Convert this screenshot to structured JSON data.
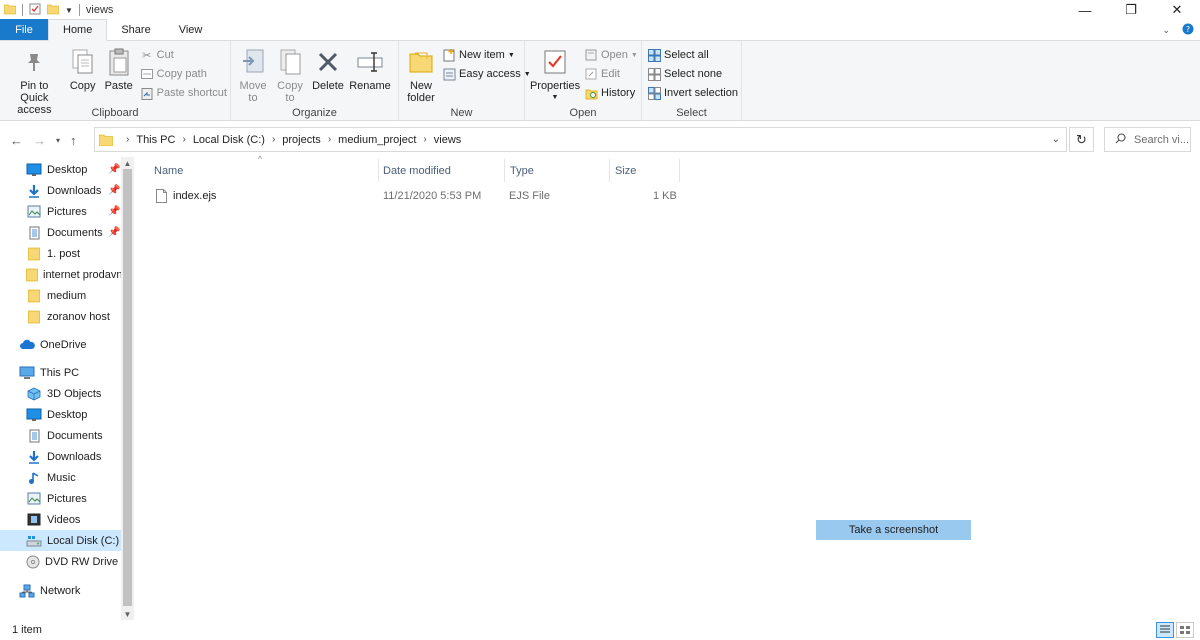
{
  "window": {
    "title": "views",
    "controls": {
      "minimize": "—",
      "maximize": "❐",
      "close": "✕"
    }
  },
  "ribbon_tabs": [
    {
      "label": "File"
    },
    {
      "label": "Home"
    },
    {
      "label": "Share"
    },
    {
      "label": "View"
    }
  ],
  "ribbon": {
    "clipboard": {
      "group_label": "Clipboard",
      "pin_line1": "Pin to Quick",
      "pin_line2": "access",
      "copy": "Copy",
      "paste": "Paste",
      "cut": "Cut",
      "copy_path": "Copy path",
      "paste_shortcut": "Paste shortcut"
    },
    "organize": {
      "group_label": "Organize",
      "move_line1": "Move",
      "move_line2": "to",
      "copy_line1": "Copy",
      "copy_line2": "to",
      "delete": "Delete",
      "rename": "Rename"
    },
    "new": {
      "group_label": "New",
      "new_folder_line1": "New",
      "new_folder_line2": "folder",
      "new_item": "New item",
      "easy_access": "Easy access"
    },
    "open": {
      "group_label": "Open",
      "properties": "Properties",
      "open": "Open",
      "edit": "Edit",
      "history": "History"
    },
    "select": {
      "group_label": "Select",
      "select_all": "Select all",
      "select_none": "Select none",
      "invert_selection": "Invert selection"
    }
  },
  "address_bar": {
    "breadcrumbs": [
      "This PC",
      "Local Disk (C:)",
      "projects",
      "medium_project",
      "views"
    ],
    "search_placeholder": "Search vi..."
  },
  "nav_pane": {
    "quick_access": [
      {
        "label": "Desktop",
        "icon": "desktop-icon",
        "pinned": true
      },
      {
        "label": "Downloads",
        "icon": "downloads-icon",
        "pinned": true
      },
      {
        "label": "Pictures",
        "icon": "pictures-icon",
        "pinned": true
      },
      {
        "label": "Documents",
        "icon": "documents-icon",
        "pinned": true
      },
      {
        "label": "1. post",
        "icon": "folder-icon",
        "pinned": false
      },
      {
        "label": "internet prodavn",
        "icon": "folder-icon",
        "pinned": false
      },
      {
        "label": "medium",
        "icon": "folder-icon",
        "pinned": false
      },
      {
        "label": "zoranov host",
        "icon": "folder-icon",
        "pinned": false
      }
    ],
    "onedrive": "OneDrive",
    "this_pc": "This PC",
    "this_pc_items": [
      {
        "label": "3D Objects",
        "icon": "3d-objects-icon"
      },
      {
        "label": "Desktop",
        "icon": "desktop-icon"
      },
      {
        "label": "Documents",
        "icon": "documents-icon"
      },
      {
        "label": "Downloads",
        "icon": "downloads-icon"
      },
      {
        "label": "Music",
        "icon": "music-icon"
      },
      {
        "label": "Pictures",
        "icon": "pictures-icon"
      },
      {
        "label": "Videos",
        "icon": "videos-icon"
      },
      {
        "label": "Local Disk (C:)",
        "icon": "local-disk-icon",
        "selected": true
      },
      {
        "label": "DVD RW Drive (E",
        "icon": "dvd-drive-icon"
      }
    ],
    "network": "Network"
  },
  "file_list": {
    "columns": {
      "name": "Name",
      "date": "Date modified",
      "type": "Type",
      "size": "Size"
    },
    "rows": [
      {
        "name": "index.ejs",
        "date": "11/21/2020 5:53 PM",
        "type": "EJS File",
        "size": "1 KB"
      }
    ]
  },
  "overlay_button": "Take a screenshot",
  "status_bar": {
    "item_count": "1 item"
  }
}
